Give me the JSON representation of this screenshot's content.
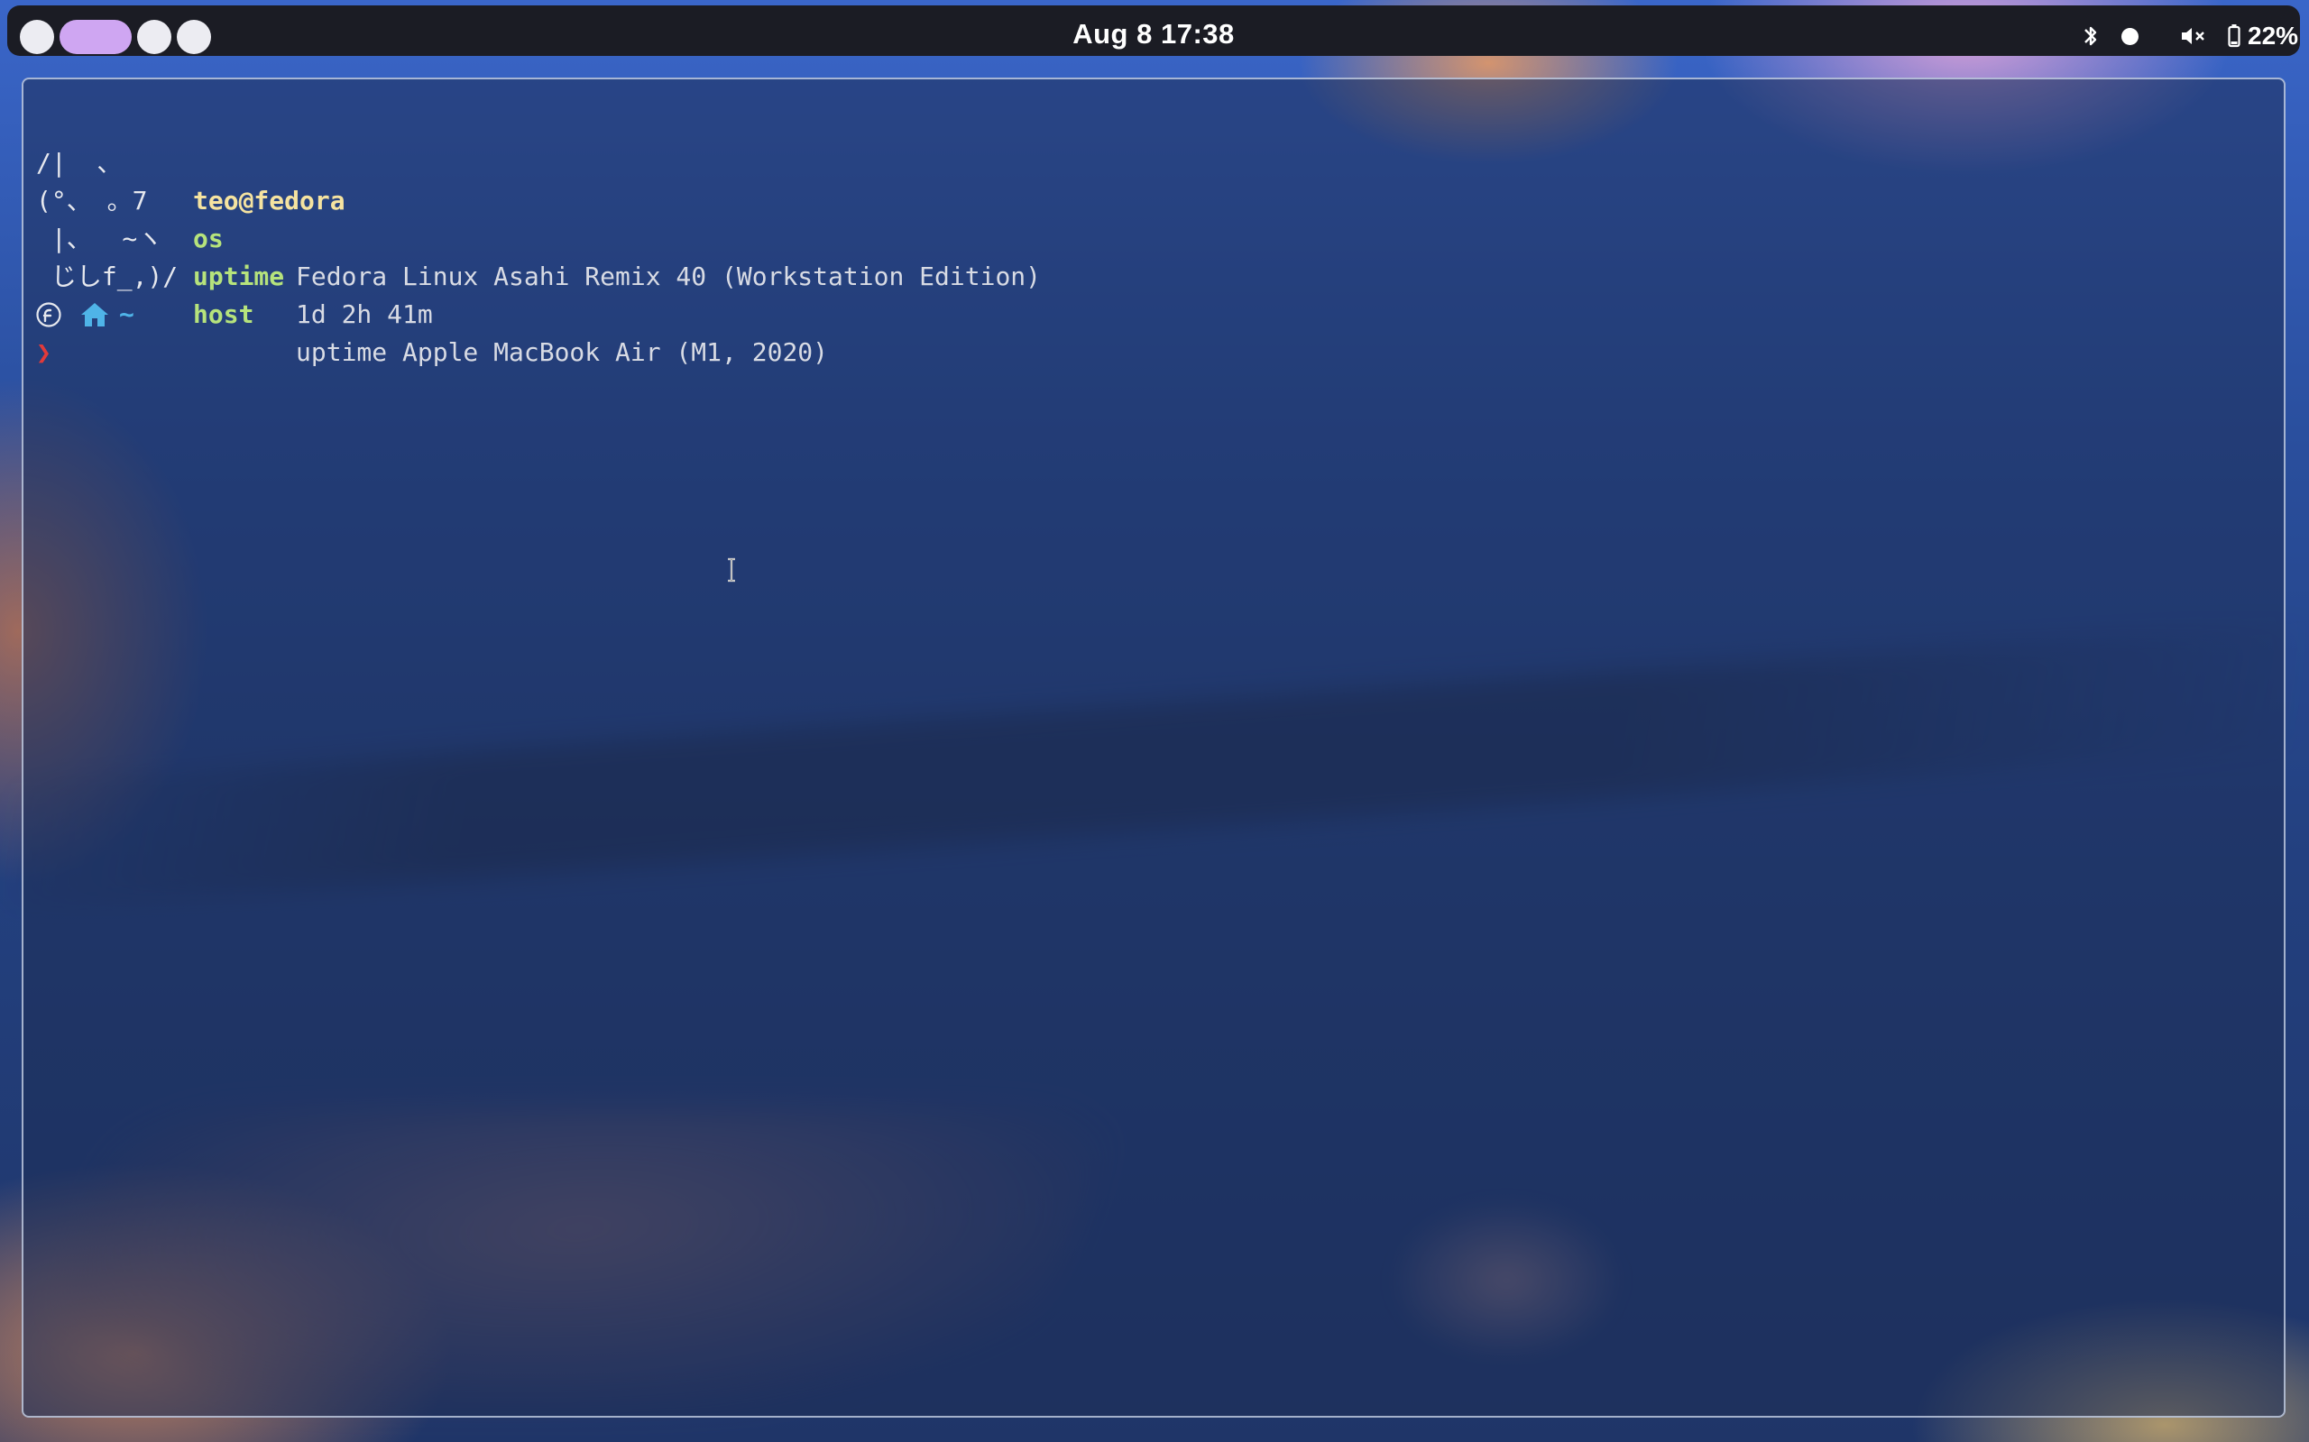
{
  "topbar": {
    "workspaces": [
      {
        "label": "workspace-1",
        "active": false
      },
      {
        "label": "workspace-2",
        "active": true
      },
      {
        "label": "workspace-3",
        "active": false
      },
      {
        "label": "workspace-4",
        "active": false
      }
    ],
    "clock": "Aug 8 17:38",
    "tray": {
      "bluetooth_icon": "bluetooth-icon",
      "status_icon": "circle-dot-icon",
      "volume_icon": "volume-muted-icon",
      "battery_icon": "battery-icon",
      "battery_percent": "22%"
    }
  },
  "terminal": {
    "fetch": {
      "art": [
        "/|  、",
        "(°、 。7",
        " |、  ~ヽ",
        " じしf_,)/"
      ],
      "user": "teo@fedora",
      "rows": [
        {
          "key": "os",
          "value": "Fedora Linux Asahi Remix 40 (Workstation Edition)"
        },
        {
          "key": "uptime",
          "value": "1d 2h 41m"
        },
        {
          "key": "host",
          "value": "uptime Apple MacBook Air (M1, 2020)"
        }
      ]
    },
    "prompt": {
      "os_icon": "fedora-icon",
      "dir_icon": "home-icon",
      "cwd": "~",
      "symbol": "❯"
    }
  },
  "colors": {
    "bar_bg": "#1b1c24",
    "workspace_active": "#cfa6f2",
    "workspace_inactive": "#ececf2",
    "fetch_key": "#b6e37c",
    "fetch_user": "#f5e3a0",
    "prompt_cwd": "#4fb4e8",
    "prompt_symbol": "#e23a3a"
  }
}
